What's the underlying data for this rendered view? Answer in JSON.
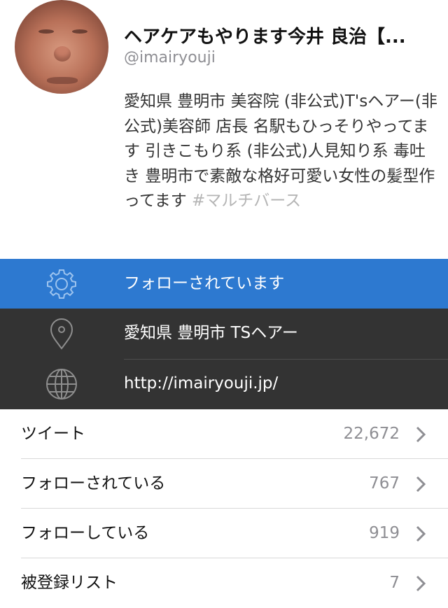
{
  "profile": {
    "name": "ヘアケアもやります今井 良治【...",
    "handle": "@imairyouji",
    "bio": "愛知県 豊明市 美容院 (非公式)T'sヘアー(非公式)美容師 店長 名駅もひっそりやってます 引きこもり系 (非公式)人見知り系 毒吐き 豊明市で素敵な格好可愛い女性の髪型作ってます ",
    "bio_hashtag": "#マルチバース"
  },
  "follow_band": {
    "icon": "gear-icon",
    "label": "フォローされています",
    "color": "#2d79d0"
  },
  "info": {
    "location": {
      "icon": "location-pin-icon",
      "text": "愛知県 豊明市 TSヘアー"
    },
    "url": {
      "icon": "globe-icon",
      "text": "http://imairyouji.jp/"
    },
    "color": "#333333"
  },
  "stats": [
    {
      "label": "ツイート",
      "value": "22,672"
    },
    {
      "label": "フォローされている",
      "value": "767"
    },
    {
      "label": "フォローしている",
      "value": "919"
    },
    {
      "label": "被登録リスト",
      "value": "7"
    }
  ]
}
